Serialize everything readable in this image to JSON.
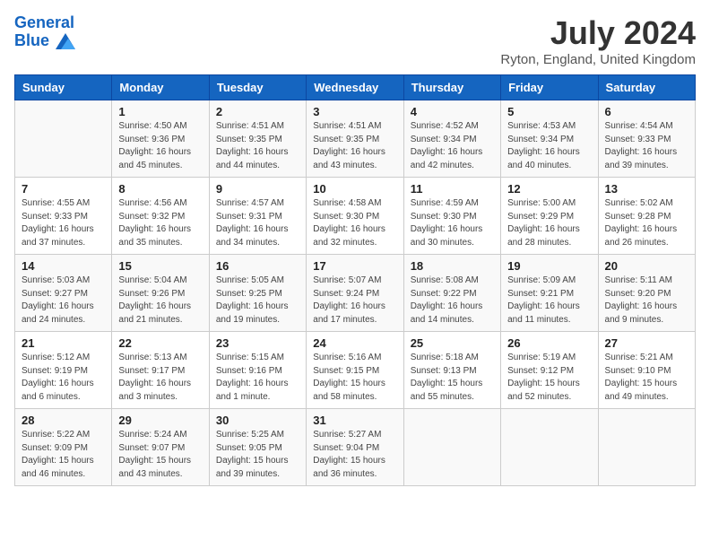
{
  "header": {
    "logo_line1": "General",
    "logo_line2": "Blue",
    "month_year": "July 2024",
    "location": "Ryton, England, United Kingdom"
  },
  "days_of_week": [
    "Sunday",
    "Monday",
    "Tuesday",
    "Wednesday",
    "Thursday",
    "Friday",
    "Saturday"
  ],
  "weeks": [
    [
      {
        "day": "",
        "info": ""
      },
      {
        "day": "1",
        "info": "Sunrise: 4:50 AM\nSunset: 9:36 PM\nDaylight: 16 hours\nand 45 minutes."
      },
      {
        "day": "2",
        "info": "Sunrise: 4:51 AM\nSunset: 9:35 PM\nDaylight: 16 hours\nand 44 minutes."
      },
      {
        "day": "3",
        "info": "Sunrise: 4:51 AM\nSunset: 9:35 PM\nDaylight: 16 hours\nand 43 minutes."
      },
      {
        "day": "4",
        "info": "Sunrise: 4:52 AM\nSunset: 9:34 PM\nDaylight: 16 hours\nand 42 minutes."
      },
      {
        "day": "5",
        "info": "Sunrise: 4:53 AM\nSunset: 9:34 PM\nDaylight: 16 hours\nand 40 minutes."
      },
      {
        "day": "6",
        "info": "Sunrise: 4:54 AM\nSunset: 9:33 PM\nDaylight: 16 hours\nand 39 minutes."
      }
    ],
    [
      {
        "day": "7",
        "info": "Sunrise: 4:55 AM\nSunset: 9:33 PM\nDaylight: 16 hours\nand 37 minutes."
      },
      {
        "day": "8",
        "info": "Sunrise: 4:56 AM\nSunset: 9:32 PM\nDaylight: 16 hours\nand 35 minutes."
      },
      {
        "day": "9",
        "info": "Sunrise: 4:57 AM\nSunset: 9:31 PM\nDaylight: 16 hours\nand 34 minutes."
      },
      {
        "day": "10",
        "info": "Sunrise: 4:58 AM\nSunset: 9:30 PM\nDaylight: 16 hours\nand 32 minutes."
      },
      {
        "day": "11",
        "info": "Sunrise: 4:59 AM\nSunset: 9:30 PM\nDaylight: 16 hours\nand 30 minutes."
      },
      {
        "day": "12",
        "info": "Sunrise: 5:00 AM\nSunset: 9:29 PM\nDaylight: 16 hours\nand 28 minutes."
      },
      {
        "day": "13",
        "info": "Sunrise: 5:02 AM\nSunset: 9:28 PM\nDaylight: 16 hours\nand 26 minutes."
      }
    ],
    [
      {
        "day": "14",
        "info": "Sunrise: 5:03 AM\nSunset: 9:27 PM\nDaylight: 16 hours\nand 24 minutes."
      },
      {
        "day": "15",
        "info": "Sunrise: 5:04 AM\nSunset: 9:26 PM\nDaylight: 16 hours\nand 21 minutes."
      },
      {
        "day": "16",
        "info": "Sunrise: 5:05 AM\nSunset: 9:25 PM\nDaylight: 16 hours\nand 19 minutes."
      },
      {
        "day": "17",
        "info": "Sunrise: 5:07 AM\nSunset: 9:24 PM\nDaylight: 16 hours\nand 17 minutes."
      },
      {
        "day": "18",
        "info": "Sunrise: 5:08 AM\nSunset: 9:22 PM\nDaylight: 16 hours\nand 14 minutes."
      },
      {
        "day": "19",
        "info": "Sunrise: 5:09 AM\nSunset: 9:21 PM\nDaylight: 16 hours\nand 11 minutes."
      },
      {
        "day": "20",
        "info": "Sunrise: 5:11 AM\nSunset: 9:20 PM\nDaylight: 16 hours\nand 9 minutes."
      }
    ],
    [
      {
        "day": "21",
        "info": "Sunrise: 5:12 AM\nSunset: 9:19 PM\nDaylight: 16 hours\nand 6 minutes."
      },
      {
        "day": "22",
        "info": "Sunrise: 5:13 AM\nSunset: 9:17 PM\nDaylight: 16 hours\nand 3 minutes."
      },
      {
        "day": "23",
        "info": "Sunrise: 5:15 AM\nSunset: 9:16 PM\nDaylight: 16 hours\nand 1 minute."
      },
      {
        "day": "24",
        "info": "Sunrise: 5:16 AM\nSunset: 9:15 PM\nDaylight: 15 hours\nand 58 minutes."
      },
      {
        "day": "25",
        "info": "Sunrise: 5:18 AM\nSunset: 9:13 PM\nDaylight: 15 hours\nand 55 minutes."
      },
      {
        "day": "26",
        "info": "Sunrise: 5:19 AM\nSunset: 9:12 PM\nDaylight: 15 hours\nand 52 minutes."
      },
      {
        "day": "27",
        "info": "Sunrise: 5:21 AM\nSunset: 9:10 PM\nDaylight: 15 hours\nand 49 minutes."
      }
    ],
    [
      {
        "day": "28",
        "info": "Sunrise: 5:22 AM\nSunset: 9:09 PM\nDaylight: 15 hours\nand 46 minutes."
      },
      {
        "day": "29",
        "info": "Sunrise: 5:24 AM\nSunset: 9:07 PM\nDaylight: 15 hours\nand 43 minutes."
      },
      {
        "day": "30",
        "info": "Sunrise: 5:25 AM\nSunset: 9:05 PM\nDaylight: 15 hours\nand 39 minutes."
      },
      {
        "day": "31",
        "info": "Sunrise: 5:27 AM\nSunset: 9:04 PM\nDaylight: 15 hours\nand 36 minutes."
      },
      {
        "day": "",
        "info": ""
      },
      {
        "day": "",
        "info": ""
      },
      {
        "day": "",
        "info": ""
      }
    ]
  ]
}
